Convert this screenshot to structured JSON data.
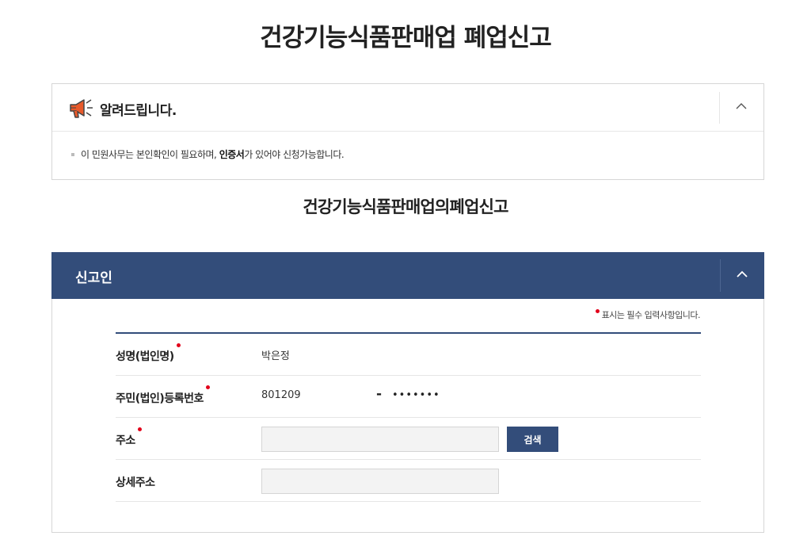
{
  "page": {
    "title": "건강기능식품판매업 폐업신고"
  },
  "notice": {
    "title": "알려드립니다.",
    "text_before": "이 민원사무는 본인확인이 필요하며, ",
    "text_bold": "인증서",
    "text_after": "가 있어야 신청가능합니다.",
    "icon": "megaphone-icon"
  },
  "section": {
    "title": "건강기능식품판매업의폐업신고"
  },
  "panel": {
    "title": "신고인",
    "required_note": "표시는 필수 입력사항입니다.",
    "colors": {
      "header_bg": "#334d7a",
      "required_dot": "#e2001a"
    }
  },
  "form": {
    "name_label": "성명(법인명)",
    "name_value": "박은정",
    "id_label": "주민(법인)등록번호",
    "id_front": "801209",
    "id_dash": "-",
    "id_back": "•••••••",
    "address_label": "주소",
    "address_value": "",
    "search_label": "검색",
    "detail_label": "상세주소",
    "detail_value": ""
  }
}
